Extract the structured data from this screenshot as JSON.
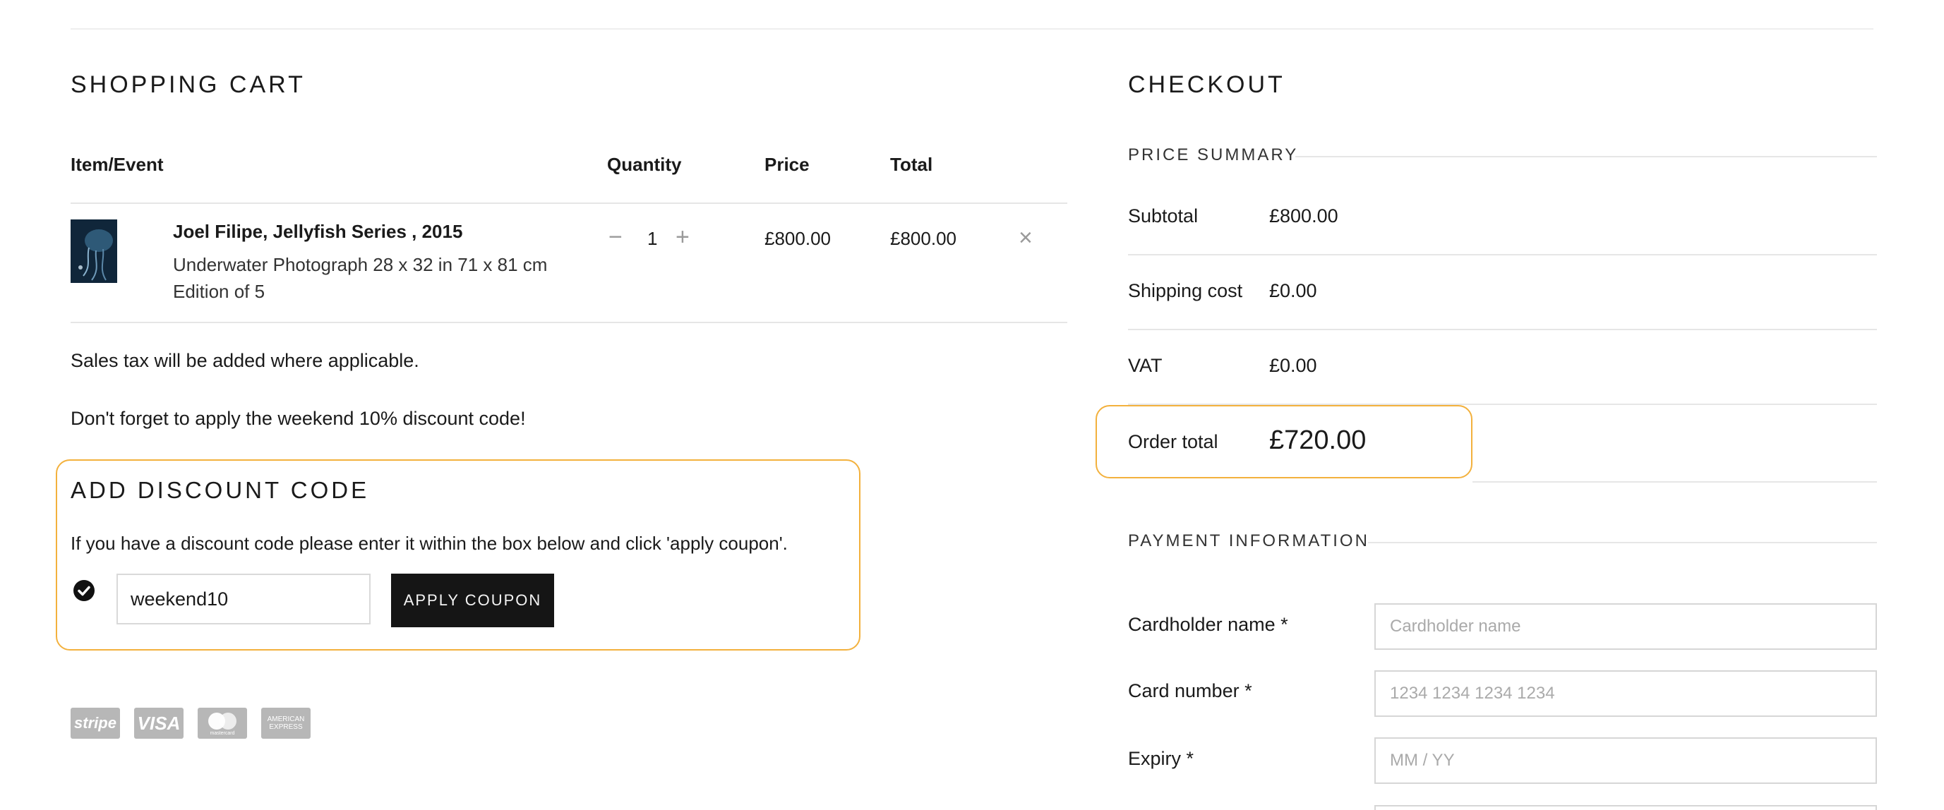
{
  "cart": {
    "title": "SHOPPING CART",
    "columns": {
      "item": "Item/Event",
      "quantity": "Quantity",
      "price": "Price",
      "total": "Total"
    },
    "item": {
      "title": "Joel Filipe, Jellyfish Series , 2015",
      "line1": "Underwater Photograph 28 x 32 in 71 x 81 cm",
      "line2": "Edition of 5",
      "quantity": "1",
      "minus": "−",
      "plus": "+",
      "price": "£800.00",
      "total": "£800.00",
      "remove": "×"
    },
    "tax_note": "Sales tax will be added where applicable.",
    "reminder": "Don't forget to apply the weekend 10% discount code!"
  },
  "discount": {
    "title": "ADD DISCOUNT CODE",
    "description": "If you have a discount code please enter it within the box below and click 'apply coupon'.",
    "code_value": "weekend10",
    "apply_label": "APPLY COUPON"
  },
  "payment_icons": {
    "stripe": "stripe",
    "visa": "VISA",
    "mastercard": "mastercard",
    "amex_line1": "AMERICAN",
    "amex_line2": "EXPRESS"
  },
  "checkout": {
    "title": "CHECKOUT",
    "price_summary_title": "PRICE SUMMARY",
    "subtotal_label": "Subtotal",
    "subtotal_value": "£800.00",
    "shipping_label": "Shipping cost",
    "shipping_value": "£0.00",
    "vat_label": "VAT",
    "vat_value": "£0.00",
    "order_total_label": "Order total",
    "order_total_value": "£720.00",
    "payment_info_title": "PAYMENT INFORMATION",
    "cardholder_label": "Cardholder name *",
    "cardholder_placeholder": "Cardholder name",
    "card_number_label": "Card number *",
    "card_number_placeholder": "1234 1234 1234 1234",
    "expiry_label": "Expiry *",
    "expiry_placeholder": "MM / YY"
  },
  "colors": {
    "highlight": "#f3b13d",
    "button_dark": "#151515",
    "badge_grey": "#b7b7b7"
  }
}
